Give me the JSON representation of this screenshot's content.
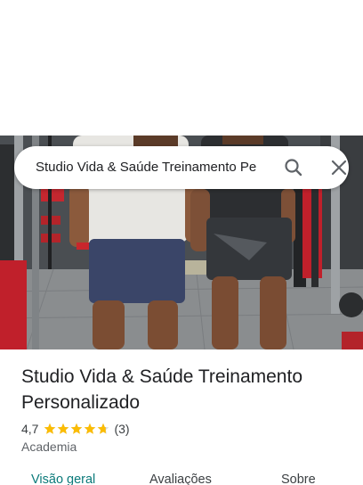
{
  "search": {
    "query": "Studio Vida & Saúde Treinamento Pe"
  },
  "place": {
    "name": "Studio Vida & Saúde Treinamento Personalizado",
    "rating": "4,7",
    "rating_value": 4.7,
    "review_count": "(3)",
    "category": "Academia"
  },
  "tabs": [
    {
      "label": "Visão geral",
      "active": true
    },
    {
      "label": "Avaliações",
      "active": false
    },
    {
      "label": "Sobre",
      "active": false
    }
  ],
  "colors": {
    "star": "#fbbc04",
    "active_tab": "#0b7a7a"
  },
  "icons": {
    "search": "search-icon",
    "close": "close-icon",
    "star": "star-icon"
  }
}
